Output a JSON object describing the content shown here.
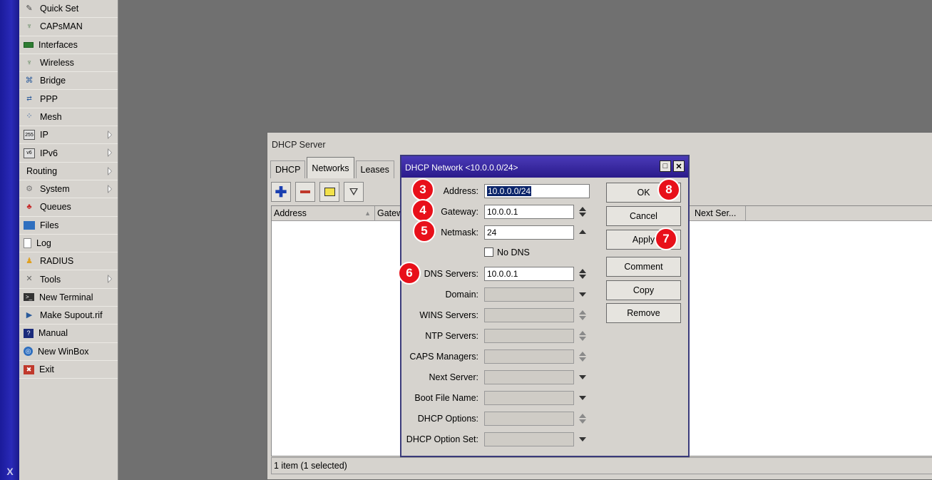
{
  "sidebar": {
    "stripe_text": "X",
    "items": [
      {
        "label": "Quick Set",
        "icon": "wand-icon",
        "arrow": false
      },
      {
        "label": "CAPsMAN",
        "icon": "antenna-icon",
        "arrow": false
      },
      {
        "label": "Interfaces",
        "icon": "interfaces-icon",
        "arrow": false
      },
      {
        "label": "Wireless",
        "icon": "antenna-icon",
        "arrow": false
      },
      {
        "label": "Bridge",
        "icon": "bridge-icon",
        "arrow": false
      },
      {
        "label": "PPP",
        "icon": "ppp-icon",
        "arrow": false
      },
      {
        "label": "Mesh",
        "icon": "mesh-icon",
        "arrow": false
      },
      {
        "label": "IP",
        "icon": "ip-icon",
        "arrow": true
      },
      {
        "label": "IPv6",
        "icon": "ipv6-icon",
        "arrow": true
      },
      {
        "label": "Routing",
        "icon": "",
        "arrow": true
      },
      {
        "label": "System",
        "icon": "gear-icon",
        "arrow": true
      },
      {
        "label": "Queues",
        "icon": "queues-icon",
        "arrow": false
      },
      {
        "label": "Files",
        "icon": "folder-icon",
        "arrow": false
      },
      {
        "label": "Log",
        "icon": "log-icon",
        "arrow": false
      },
      {
        "label": "RADIUS",
        "icon": "radius-icon",
        "arrow": false
      },
      {
        "label": "Tools",
        "icon": "tools-icon",
        "arrow": true
      },
      {
        "label": "New Terminal",
        "icon": "terminal-icon",
        "arrow": false
      },
      {
        "label": "Make Supout.rif",
        "icon": "supout-icon",
        "arrow": false
      },
      {
        "label": "Manual",
        "icon": "manual-icon",
        "arrow": false
      },
      {
        "label": "New WinBox",
        "icon": "winbox-icon",
        "arrow": false
      },
      {
        "label": "Exit",
        "icon": "exit-icon",
        "arrow": false
      }
    ]
  },
  "dhcp_window": {
    "title": "DHCP Server",
    "tabs": [
      "DHCP",
      "Networks",
      "Leases"
    ],
    "active_tab": "Networks",
    "columns": [
      "Address",
      "Gatew",
      "Next Ser..."
    ],
    "status": "1 item (1 selected)"
  },
  "dialog": {
    "title": "DHCP Network <10.0.0.0/24>",
    "fields": {
      "address": {
        "label": "Address:",
        "value": "10.0.0.0/24"
      },
      "gateway": {
        "label": "Gateway:",
        "value": "10.0.0.1"
      },
      "netmask": {
        "label": "Netmask:",
        "value": "24"
      },
      "dns_servers": {
        "label": "DNS Servers:",
        "value": "10.0.0.1"
      },
      "domain": {
        "label": "Domain:",
        "value": ""
      },
      "wins_servers": {
        "label": "WINS Servers:",
        "value": ""
      },
      "ntp_servers": {
        "label": "NTP Servers:",
        "value": ""
      },
      "caps_managers": {
        "label": "CAPS Managers:",
        "value": ""
      },
      "next_server": {
        "label": "Next Server:",
        "value": ""
      },
      "boot_file_name": {
        "label": "Boot File Name:",
        "value": ""
      },
      "dhcp_options": {
        "label": "DHCP Options:",
        "value": ""
      },
      "dhcp_option_set": {
        "label": "DHCP Option Set:",
        "value": ""
      }
    },
    "no_dns_label": "No DNS",
    "no_dns_checked": false,
    "buttons": {
      "ok": "OK",
      "cancel": "Cancel",
      "apply": "Apply",
      "comment": "Comment",
      "copy": "Copy",
      "remove": "Remove"
    }
  },
  "callouts": [
    "3",
    "4",
    "5",
    "6",
    "7",
    "8"
  ],
  "colors": {
    "callout": "#e8101a",
    "dialog_title": "#2a1a8a",
    "sidebar_stripe": "#1a1a9a"
  }
}
